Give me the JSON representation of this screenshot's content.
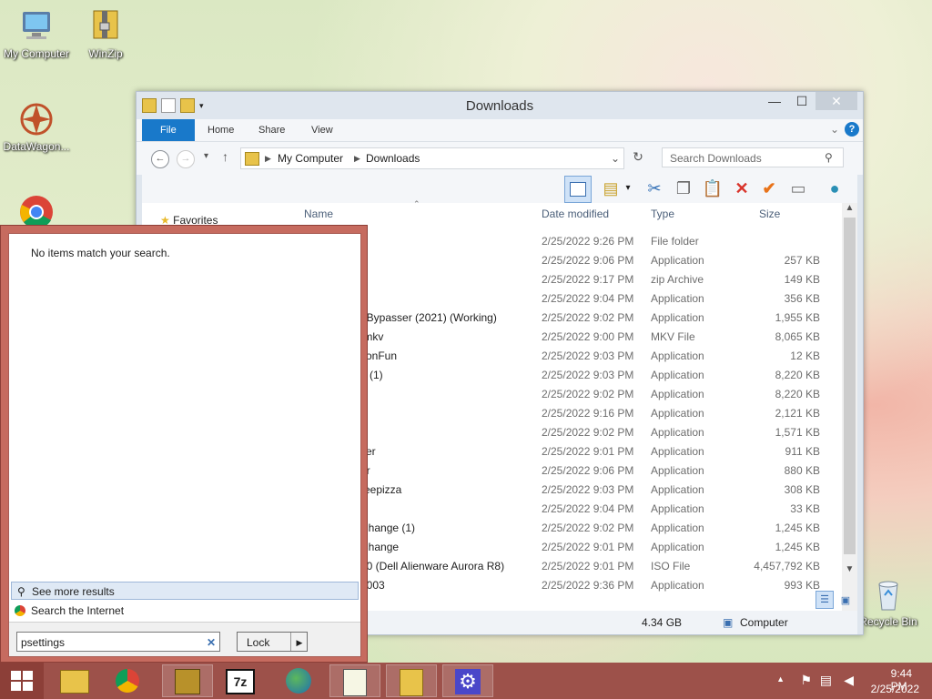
{
  "desktop": {
    "icons": [
      {
        "label": "My Computer"
      },
      {
        "label": "WinZip"
      },
      {
        "label": "DataWagon..."
      },
      {
        "label": "Recycle Bin"
      }
    ]
  },
  "explorer": {
    "title": "Downloads",
    "ribbon_tabs": [
      "File",
      "Home",
      "Share",
      "View"
    ],
    "breadcrumb": [
      "My Computer",
      "Downloads"
    ],
    "search_placeholder": "Search Downloads",
    "nav": {
      "favorites": "Favorites"
    },
    "columns": {
      "name": "Name",
      "date": "Date modified",
      "type": "Type",
      "size": "Size"
    },
    "rows": [
      {
        "name": "",
        "date": "2/25/2022 9:26 PM",
        "type": "File folder",
        "size": ""
      },
      {
        "name": "",
        "date": "2/25/2022 9:06 PM",
        "type": "Application",
        "size": "257 KB"
      },
      {
        "name": "",
        "date": "2/25/2022 9:17 PM",
        "type": "zip Archive",
        "size": "149 KB"
      },
      {
        "name": "",
        "date": "2/25/2022 9:04 PM",
        "type": "Application",
        "size": "356 KB"
      },
      {
        "name": "t Bypasser (2021) (Working)",
        "date": "2/25/2022 9:02 PM",
        "type": "Application",
        "size": "1,955 KB"
      },
      {
        "name": ".mkv",
        "date": "2/25/2022 9:00 PM",
        "type": "MKV File",
        "size": "8,065 KB"
      },
      {
        "name": "conFun",
        "date": "2/25/2022 9:03 PM",
        "type": "Application",
        "size": "12 KB"
      },
      {
        "name": "2 (1)",
        "date": "2/25/2022 9:03 PM",
        "type": "Application",
        "size": "8,220 KB"
      },
      {
        "name": "2",
        "date": "2/25/2022 9:02 PM",
        "type": "Application",
        "size": "8,220 KB"
      },
      {
        "name": "",
        "date": "2/25/2022 9:16 PM",
        "type": "Application",
        "size": "2,121 KB"
      },
      {
        "name": "",
        "date": "2/25/2022 9:02 PM",
        "type": "Application",
        "size": "1,571 KB"
      },
      {
        "name": "ser",
        "date": "2/25/2022 9:01 PM",
        "type": "Application",
        "size": "911 KB"
      },
      {
        "name": "er",
        "date": "2/25/2022 9:06 PM",
        "type": "Application",
        "size": "880 KB"
      },
      {
        "name": "reepizza",
        "date": "2/25/2022 9:03 PM",
        "type": "Application",
        "size": "308 KB"
      },
      {
        "name": "",
        "date": "2/25/2022 9:04 PM",
        "type": "Application",
        "size": "33 KB"
      },
      {
        "name": "Change (1)",
        "date": "2/25/2022 9:02 PM",
        "type": "Application",
        "size": "1,245 KB"
      },
      {
        "name": "Change",
        "date": "2/25/2022 9:01 PM",
        "type": "Application",
        "size": "1,245 KB"
      },
      {
        "name": "10 (Dell Alienware Aurora R8)",
        "date": "2/25/2022 9:01 PM",
        "type": "ISO File",
        "size": "4,457,792 KB"
      },
      {
        "name": "p003",
        "date": "2/25/2022 9:36 PM",
        "type": "Application",
        "size": "993 KB"
      }
    ],
    "status": {
      "free_space": "4.34 GB",
      "location": "Computer"
    }
  },
  "search_panel": {
    "empty_message": "No items match your search.",
    "see_more": "See more results",
    "search_internet": "Search the Internet",
    "query": "psettings",
    "power_button": "Lock"
  },
  "taskbar": {
    "clock_time": "9:44 PM",
    "clock_date": "2/25/2022"
  }
}
